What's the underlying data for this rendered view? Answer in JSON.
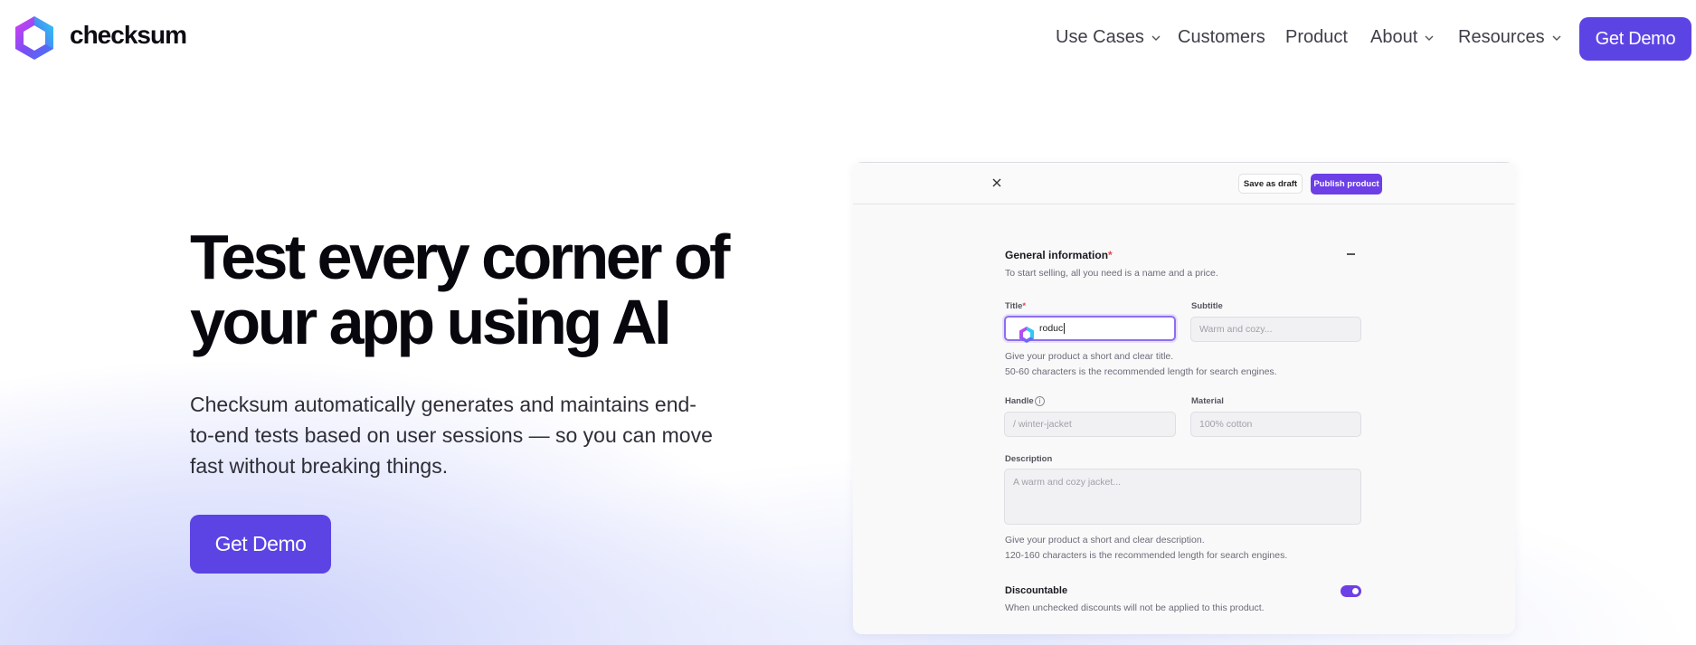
{
  "header": {
    "logo_text": "checksum",
    "nav": [
      {
        "label": "Use Cases",
        "dropdown": true
      },
      {
        "label": "Customers",
        "dropdown": false
      },
      {
        "label": "Product",
        "dropdown": false
      },
      {
        "label": "About",
        "dropdown": true
      },
      {
        "label": "Resources",
        "dropdown": true
      }
    ],
    "cta_label": "Get Demo"
  },
  "hero": {
    "title_line1": "Test every corner of",
    "title_line2": "your app using AI",
    "subtitle": "Checksum automatically generates and maintains end-to-end tests based on user sessions — so you can move fast without breaking things.",
    "cta_label": "Get Demo"
  },
  "mock": {
    "close_icon": "close-icon",
    "save_draft_label": "Save as draft",
    "publish_label": "Publish product",
    "section_title": "General information",
    "required_mark": "*",
    "section_desc": "To start selling, all you need is a name and a price.",
    "title_label": "Title",
    "title_value": "roduc",
    "subtitle_label": "Subtitle",
    "subtitle_placeholder": "Warm and cozy...",
    "title_hint1": "Give your product a short and clear title.",
    "title_hint2": "50-60 characters is the recommended length for search engines.",
    "handle_label": "Handle",
    "handle_placeholder": "/ winter-jacket",
    "material_label": "Material",
    "material_placeholder": "100% cotton",
    "description_label": "Description",
    "description_placeholder": "A warm and cozy jacket...",
    "desc_hint1": "Give your product a short and clear description.",
    "desc_hint2": "120-160 characters is the recommended length for search engines.",
    "discountable_label": "Discountable",
    "discountable_on": true,
    "discountable_hint": "When unchecked discounts will not be applied to this product."
  },
  "colors": {
    "brand": "#5c44e4",
    "publish": "#6d3fe6"
  }
}
